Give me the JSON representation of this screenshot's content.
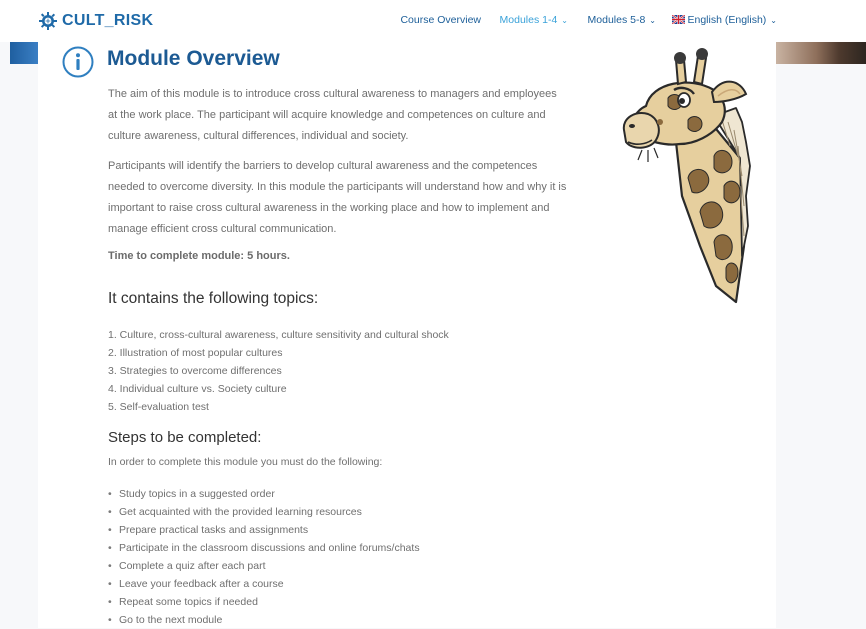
{
  "brand": {
    "logo_text": "CULT_RISK",
    "logo_icon": "gear-globe-icon",
    "color": "#1f6aa8"
  },
  "nav": {
    "course_overview": "Course Overview",
    "modules_1_4": "Modules 1-4",
    "modules_5_8": "Modules 5-8",
    "language": "English (English)",
    "active_color": "#3aa2d9"
  },
  "module": {
    "icon": "info-icon",
    "title": "Module Overview",
    "paragraph_1": "The aim of this module is to introduce cross cultural awareness to managers and employees at the work place. The participant will acquire knowledge and competences on culture and culture awareness, cultural differences, individual and society.",
    "paragraph_2": "Participants will identify the barriers to develop cultural awareness and the competences needed to overcome diversity. In this module the participants will understand how and why it is important to raise cross cultural awareness in the working place and how to implement and manage efficient cross cultural communication.",
    "time_label": "Time to complete module: 5 hours."
  },
  "topics": {
    "heading": "It contains the following topics:",
    "items": [
      "1. Culture, cross-cultural awareness, culture sensitivity and cultural shock",
      "2. Illustration of most popular cultures",
      "3. Strategies to overcome differences",
      "4. Individual culture vs. Society culture",
      "5. Self-evaluation test"
    ]
  },
  "steps": {
    "heading": "Steps to be completed:",
    "intro": "In order to complete this module you must do the following:",
    "items": [
      "Study topics in a suggested order",
      "Get acquainted with the provided learning resources",
      "Prepare practical tasks and assignments",
      "Participate in the classroom discussions and online forums/chats",
      "Complete a quiz after each part",
      "Leave your feedback after a course",
      "Repeat some topics if needed",
      "Go to the next module"
    ]
  },
  "illustration": {
    "icon": "giraffe-illustration"
  }
}
